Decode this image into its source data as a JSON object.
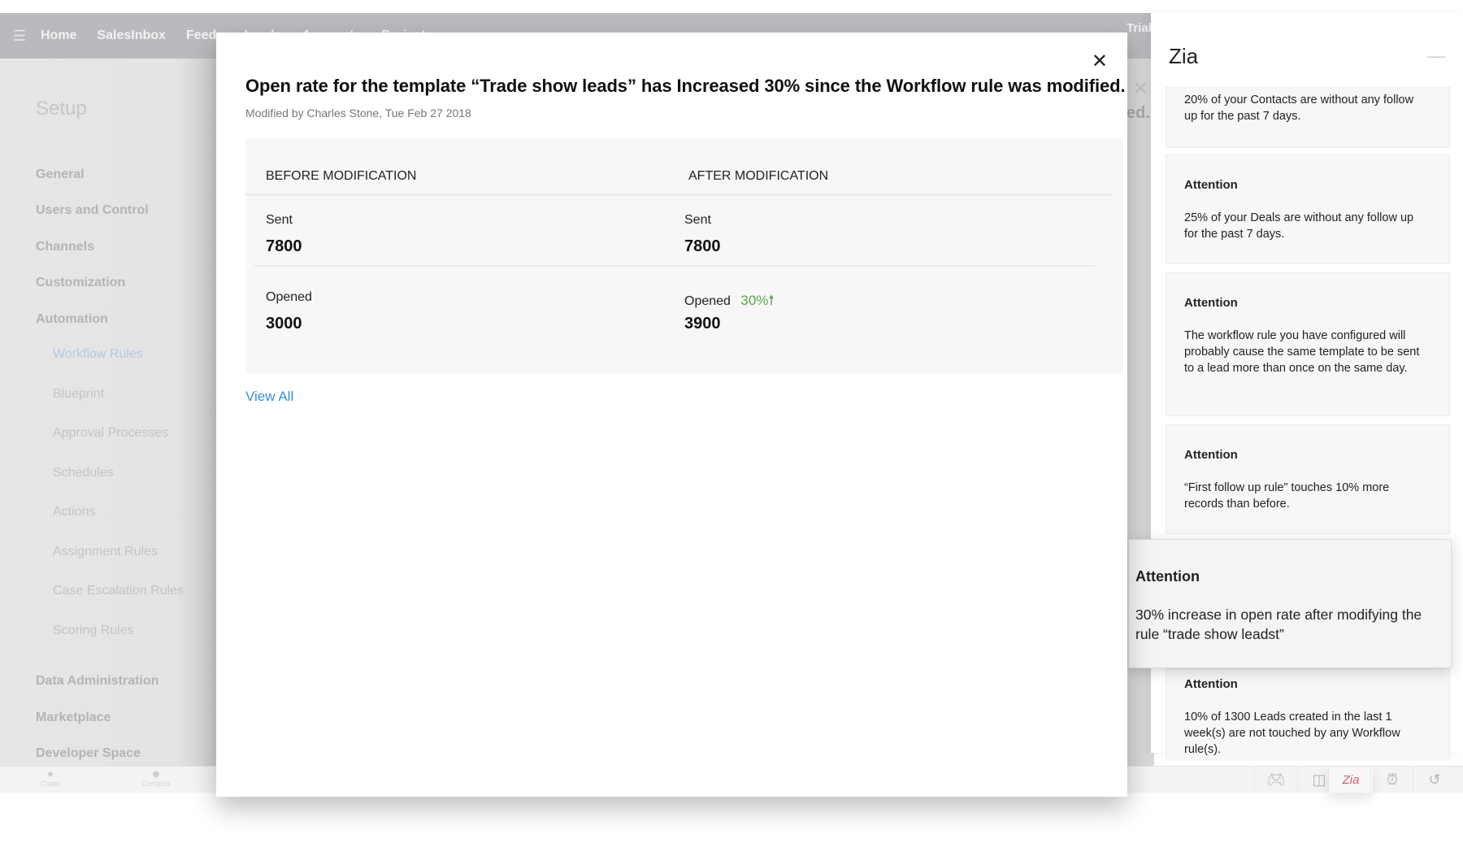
{
  "topbar": {
    "menu_icon": "hamburger-menu-icon",
    "nav": [
      "Home",
      "SalesInbox",
      "Feeds",
      "Leads",
      "Accounts",
      "Projects",
      "•••"
    ],
    "trial_label": "Trial"
  },
  "sidebar": {
    "title": "Setup",
    "sections": [
      {
        "label": "General"
      },
      {
        "label": "Users and Control"
      },
      {
        "label": "Channels"
      },
      {
        "label": "Customization"
      },
      {
        "label": "Automation"
      }
    ],
    "automation_items": [
      {
        "label": "Workflow Rules",
        "active": true
      },
      {
        "label": "Blueprint"
      },
      {
        "label": "Approval Processes"
      },
      {
        "label": "Schedules"
      },
      {
        "label": "Actions"
      },
      {
        "label": "Assignment Rules"
      },
      {
        "label": "Case Escalation Rules"
      },
      {
        "label": "Scoring Rules"
      }
    ],
    "more_sections": [
      {
        "label": "Data Administration"
      },
      {
        "label": "Marketplace"
      },
      {
        "label": "Developer Space"
      }
    ]
  },
  "background": {
    "ghost_text": "ed."
  },
  "modal": {
    "title": "Open rate for the template “Trade show leads” has Increased 30% since the Workflow rule was modified.",
    "subtitle": "Modified by Charles Stone, Tue Feb 27 2018",
    "before_header": "BEFORE MODIFICATION",
    "after_header": "AFTER MODIFICATION",
    "before": {
      "sent_label": "Sent",
      "sent_value": "7800",
      "opened_label": "Opened",
      "opened_value": "3000"
    },
    "after": {
      "sent_label": "Sent",
      "sent_value": "7800",
      "opened_label": "Opened",
      "opened_value": "3900",
      "opened_delta": "30%",
      "delta_color": "#5aa54a"
    },
    "view_all": "View All",
    "close_icon": "close-icon"
  },
  "zia": {
    "title": "Zia",
    "cards": [
      {
        "head": "",
        "body": "20% of your Contacts are without any follow up for the past 7 days."
      },
      {
        "head": "Attention",
        "body": "25% of your Deals are without any follow up for the past 7 days."
      },
      {
        "head": "Attention",
        "body": "The workflow rule you have configured will probably cause the same template to be sent to a lead more than once on the same day."
      },
      {
        "head": "Attention",
        "body": "“First follow up rule” touches 10% more records than before."
      },
      {
        "head": "Attention",
        "body": "10% of 1300 Leads created in the last 1 week(s) are not touched by any Workflow rule(s)."
      }
    ],
    "highlight": {
      "head": "Attention",
      "body": "30% increase in open rate after modifying the rule “trade show leadst”"
    }
  },
  "bottombar": {
    "tabs": [
      "Chats",
      "Contacts"
    ],
    "tools": [
      "gamepad-icon",
      "notes-icon",
      "zia-icon",
      "alarm-icon",
      "history-icon"
    ],
    "zia_label": "Zia",
    "zia_color": "#e05a64"
  }
}
